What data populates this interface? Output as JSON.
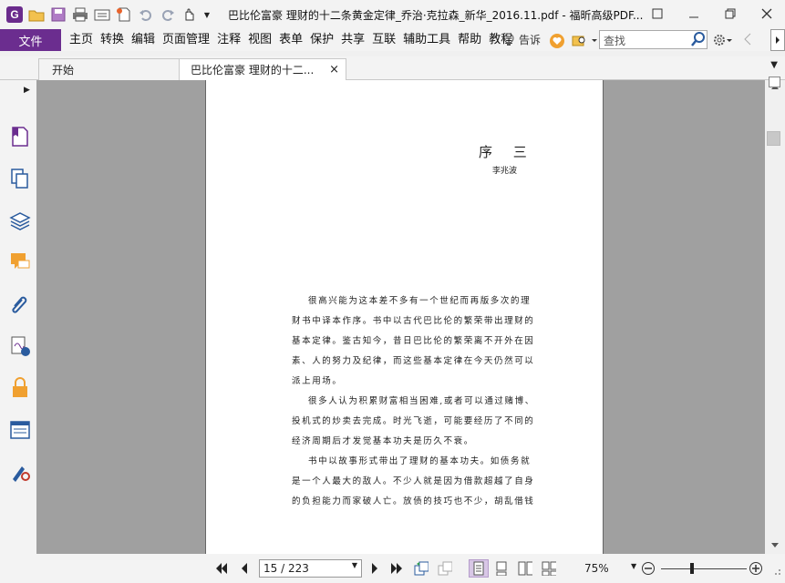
{
  "window": {
    "title": "巴比伦富豪 理财的十二条黄金定律_乔治·克拉森_新华_2016.11.pdf - 福昕高级PDF...",
    "app_logo": "G"
  },
  "menu": {
    "file_label": "文件",
    "items": [
      "主页",
      "转换",
      "编辑",
      "页面管理",
      "注释",
      "视图",
      "表单",
      "保护",
      "共享",
      "互联",
      "辅助工具",
      "帮助",
      "教程"
    ],
    "tell_me": "告诉",
    "search_placeholder": "查找"
  },
  "tabs": [
    {
      "label": "开始",
      "active": false
    },
    {
      "label": "巴比伦富豪 理财的十二...",
      "active": true,
      "close": "×"
    }
  ],
  "document": {
    "chapter_title": "序  三",
    "author": "李兆波",
    "lines": [
      "很高兴能为这本差不多有一个世纪而再版多次的理",
      "财书中译本作序。书中以古代巴比伦的繁荣带出理财的",
      "基本定律。鉴古知今，昔日巴比伦的繁荣离不开外在因",
      "素、人的努力及纪律，而这些基本定律在今天仍然可以",
      "派上用场。",
      "很多人认为积累财富相当困难,或者可以通过赌博、",
      "投机式的炒卖去完成。时光飞逝，可能要经历了不同的",
      "经济周期后才发觉基本功夫是历久不衰。",
      "书中以故事形式带出了理财的基本功夫。如债务就",
      "是一个人最大的敌人。不少人就是因为借款超越了自身",
      "的负担能力而家破人亡。放债的技巧也不少，胡乱借钱"
    ]
  },
  "statusbar": {
    "page_display": "15 / 223",
    "current_page": 15,
    "total_pages": 223,
    "zoom": "75%"
  },
  "colors": {
    "accent": "#6b2d8f",
    "workspace": "#a0a0a0"
  }
}
